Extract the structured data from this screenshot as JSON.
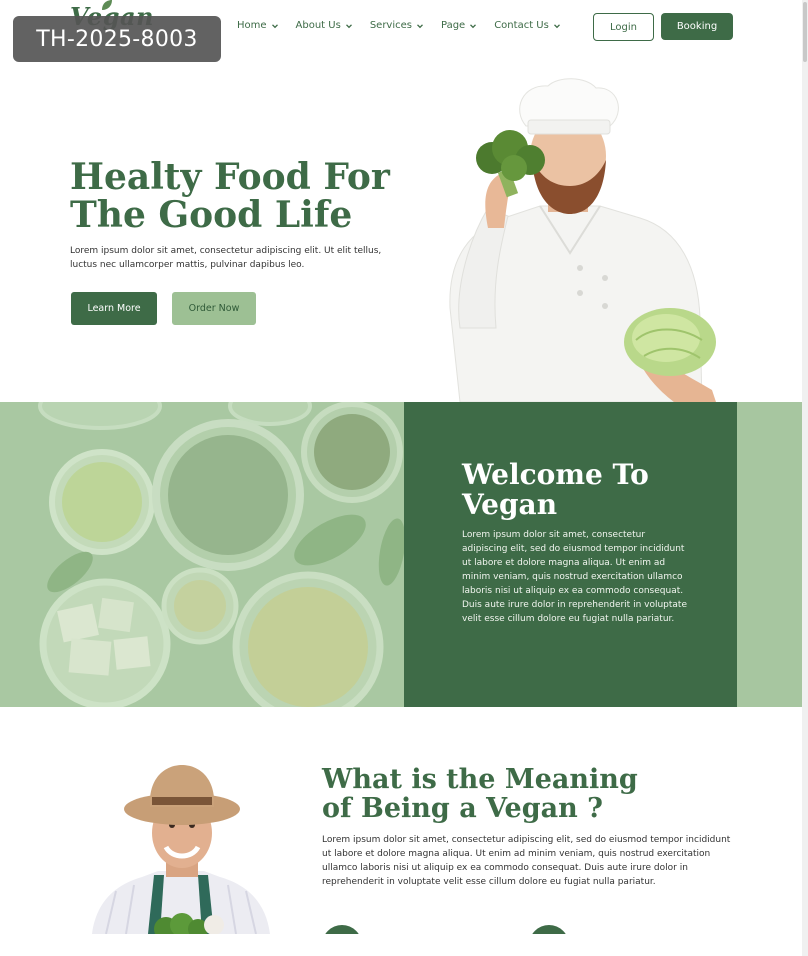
{
  "badge": {
    "text": "TH-2025-8003"
  },
  "header": {
    "logo": "Vegan",
    "nav": [
      {
        "label": "Home"
      },
      {
        "label": "About Us"
      },
      {
        "label": "Services"
      },
      {
        "label": "Page"
      },
      {
        "label": "Contact Us"
      }
    ],
    "login_label": "Login",
    "booking_label": "Booking"
  },
  "hero": {
    "title_line1": "Healty Food For",
    "title_line2": "The Good Life",
    "text": "Lorem ipsum dolor sit amet, consectetur adipiscing elit. Ut elit tellus, luctus nec ullamcorper mattis, pulvinar dapibus leo.",
    "learn_more_label": "Learn More",
    "order_now_label": "Order Now"
  },
  "welcome": {
    "title_line1": "Welcome To",
    "title_line2": "Vegan",
    "text": "Lorem ipsum dolor sit amet, consectetur adipiscing elit, sed do eiusmod tempor incididunt ut labore et dolore magna aliqua. Ut enim ad minim veniam, quis nostrud exercitation ullamco laboris nisi ut aliquip ex ea commodo consequat. Duis aute irure dolor in reprehenderit in voluptate velit esse cillum dolore eu fugiat nulla pariatur."
  },
  "meaning": {
    "title_line1": "What is the Meaning",
    "title_line2": "of Being a Vegan ?",
    "text": "Lorem ipsum dolor sit amet, consectetur adipiscing elit, sed do eiusmod tempor incididunt ut labore et dolore magna aliqua. Ut enim ad minim veniam, quis nostrud exercitation ullamco laboris nisi ut aliquip ex ea commodo consequat. Duis aute irure dolor in reprehenderit in voluptate velit esse cillum dolore eu fugiat nulla pariatur."
  },
  "colors": {
    "brand_green": "#3e6b47",
    "light_green": "#9dc094",
    "sage_background": "#a9c8a2"
  }
}
